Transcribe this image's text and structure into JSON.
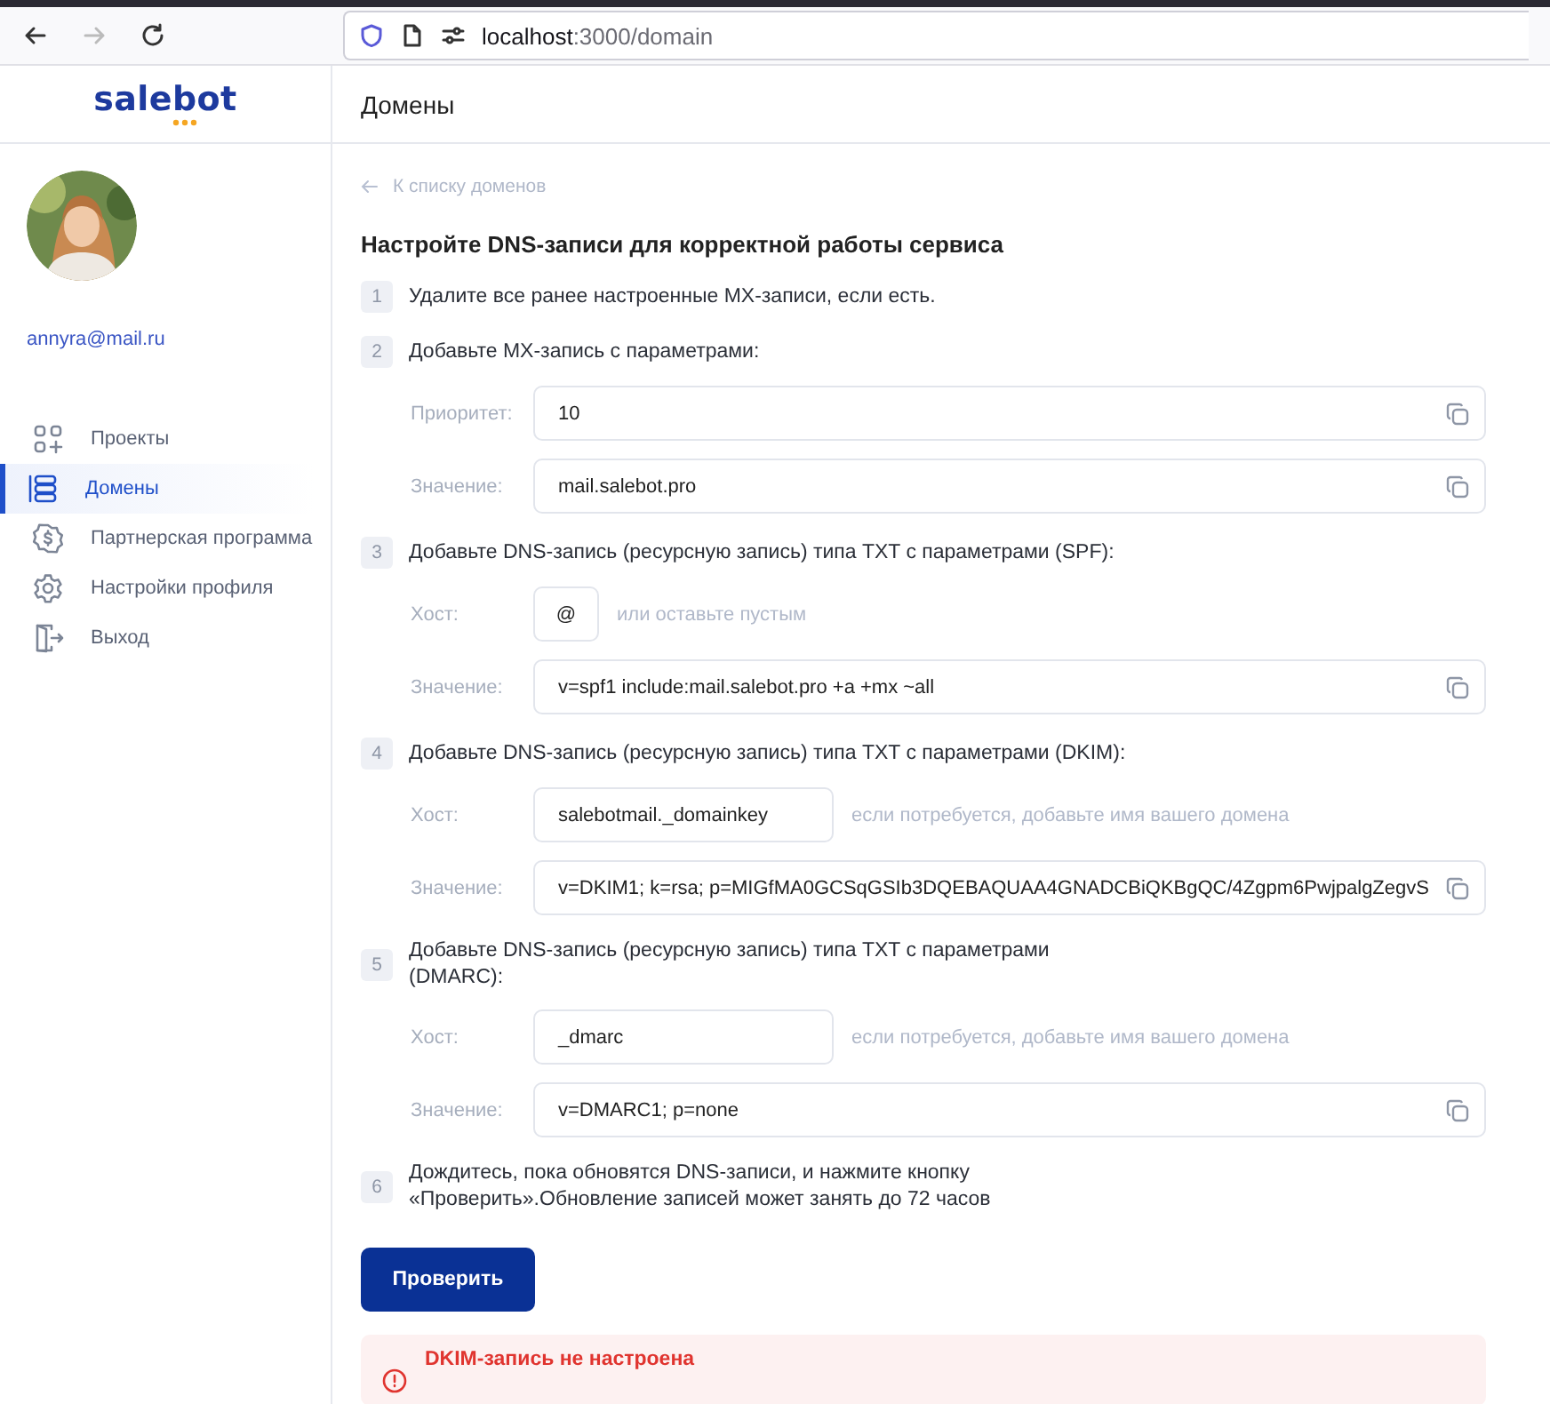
{
  "browser": {
    "url_host": "localhost",
    "url_path": ":3000/domain",
    "forward_disabled": true
  },
  "sidebar": {
    "logo": "salebot",
    "email": "annyra@mail.ru",
    "items": [
      {
        "label": "Проекты",
        "kind": "projects",
        "selected": false
      },
      {
        "label": "Домены",
        "kind": "domains",
        "selected": true
      },
      {
        "label": "Партнерская программа",
        "kind": "partner",
        "selected": false
      },
      {
        "label": "Настройки профиля",
        "kind": "settings",
        "selected": false
      },
      {
        "label": "Выход",
        "kind": "exit",
        "selected": false
      }
    ]
  },
  "header": {
    "title": "Домены"
  },
  "back_link": "К списку доменов",
  "heading": "Настройте DNS-записи для корректной работы сервиса",
  "steps": [
    {
      "number": "1",
      "text": [
        "Удалите все ранее настроенные MX-записи, если есть."
      ]
    },
    {
      "number": "2",
      "text": [
        "Добавьте MX-запись с параметрами:"
      ],
      "fields": [
        {
          "label": "Приоритет:",
          "kind": "copy",
          "value": "10"
        },
        {
          "label": "Значение:",
          "kind": "copy",
          "value": "mail.salebot.pro"
        }
      ]
    },
    {
      "number": "3",
      "text": [
        "Добавьте DNS-запись (ресурсную запись) типа TXT с параметрами (SPF):"
      ],
      "fields": [
        {
          "label": "Хост:",
          "kind": "tiny",
          "value": "@",
          "hint": "или оставьте пустым"
        },
        {
          "label": "Значение:",
          "kind": "copy",
          "value": "v=spf1 include:mail.salebot.pro +a +mx ~all"
        }
      ]
    },
    {
      "number": "4",
      "text": [
        "Добавьте DNS-запись (ресурсную запись) типа TXT с параметрами (DKIM):"
      ],
      "fields": [
        {
          "label": "Хост:",
          "kind": "host",
          "value": "salebotmail._domainkey",
          "hint": "если потребуется, добавьте имя вашего домена"
        },
        {
          "label": "Значение:",
          "kind": "copy",
          "value": "v=DKIM1; k=rsa; p=MIGfMA0GCSqGSIb3DQEBAQUAA4GNADCBiQKBgQC/4Zgpm6PwjpalgZegvS"
        }
      ]
    },
    {
      "number": "5",
      "text": [
        "Добавьте DNS-запись (ресурсную запись) типа TXT с параметрами",
        "(DMARC):"
      ],
      "fields": [
        {
          "label": "Хост:",
          "kind": "host",
          "value": "_dmarc",
          "hint": "если потребуется, добавьте имя вашего домена"
        },
        {
          "label": "Значение:",
          "kind": "copy",
          "value": "v=DMARC1; p=none"
        }
      ]
    },
    {
      "number": "6",
      "text": [
        "Дождитесь, пока обновятся DNS-записи, и нажмите кнопку",
        "«Проверить».Обновление записей может занять до 72 часов"
      ]
    }
  ],
  "button": "Проверить",
  "alert": {
    "title": "DKIM-запись не настроена"
  }
}
